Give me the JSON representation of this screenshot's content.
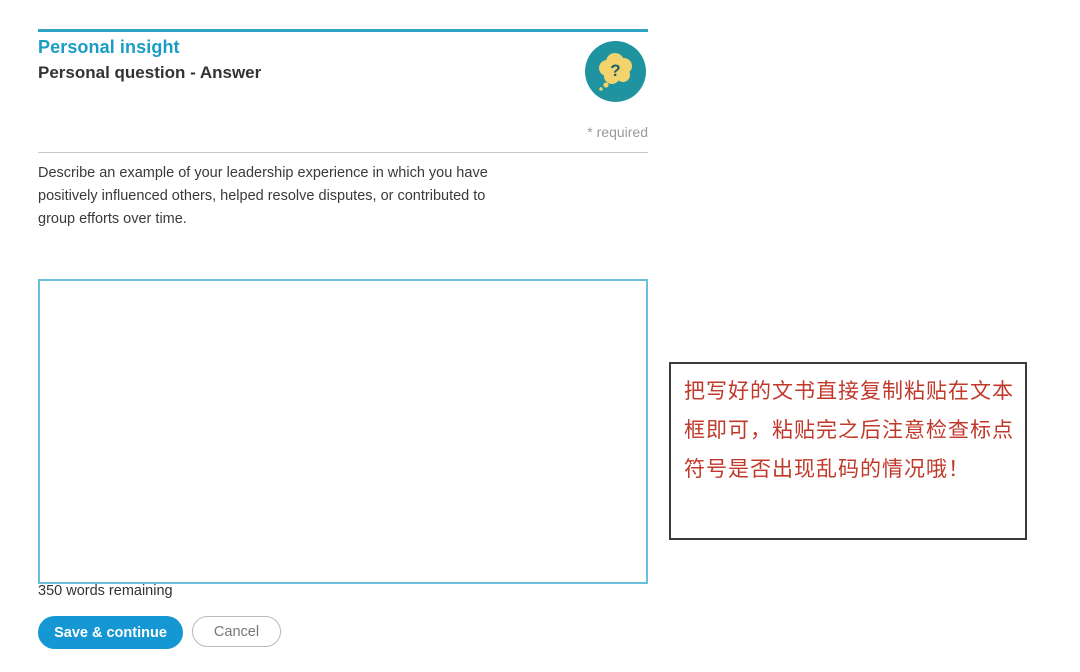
{
  "header": {
    "section_title": "Personal insight",
    "page_title": "Personal question - Answer",
    "icon": "thought-bubble-question-icon",
    "icon_color": "#1f93a0",
    "icon_accent": "#f3d36b"
  },
  "form": {
    "required_note": "* required",
    "prompt": "Describe an example of your leadership experience in which you have positively influenced others, helped resolve disputes, or contributed to group efforts over time.",
    "answer_value": "",
    "words_remaining": "350 words remaining",
    "save_label": "Save & continue",
    "cancel_label": "Cancel"
  },
  "annotation": {
    "text": "把写好的文书直接复制粘贴在文本框即可，粘贴完之后注意检查标点符号是否出现乱码的情况哦！"
  },
  "colors": {
    "accent": "#1a9cc3",
    "primary_button": "#1597d4",
    "annotation_text": "#c0392b"
  }
}
